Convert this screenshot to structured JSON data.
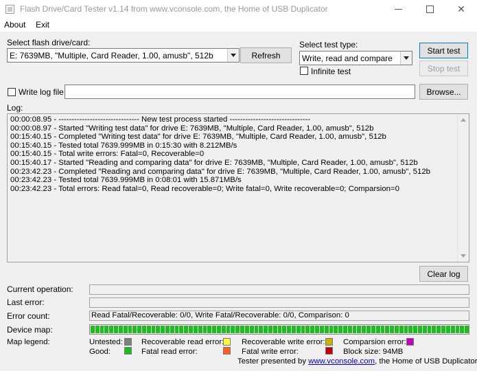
{
  "window": {
    "title": "Flash Drive/Card Tester v1.14 from www.vconsole.com, the Home of USB Duplicator"
  },
  "menu": [
    "About",
    "Exit"
  ],
  "drive": {
    "label": "Select flash drive/card:",
    "selected": "E: 7639MB, \"Multiple, Card  Reader, 1.00, amusb\", 512b",
    "refresh_label": "Refresh"
  },
  "test": {
    "label": "Select test type:",
    "selected": "Write, read and compare",
    "infinite_label": "Infinite test",
    "infinite_checked": false,
    "start_label": "Start test",
    "stop_label": "Stop test"
  },
  "logfile": {
    "write_label": "Write log file",
    "write_checked": false,
    "path": "",
    "browse_label": "Browse..."
  },
  "log": {
    "label": "Log:",
    "lines": [
      "00:00:08.95 - ------------------------------- New test process started -------------------------------",
      "00:00:08.97 - Started \"Writing test data\" for drive E: 7639MB, \"Multiple, Card  Reader, 1.00, amusb\", 512b",
      "00:15:40.15 - Completed \"Writing test data\" for drive E: 7639MB, \"Multiple, Card  Reader, 1.00, amusb\", 512b",
      "00:15:40.15 - Tested total 7639.999MB in 0:15:30 with  8.212MB/s",
      "00:15:40.15 - Total write errors: Fatal=0, Recoverable=0",
      "00:15:40.17 - Started \"Reading and comparing data\" for drive E: 7639MB, \"Multiple, Card  Reader, 1.00, amusb\", 512b",
      "00:23:42.23 - Completed \"Reading and comparing data\" for drive E: 7639MB, \"Multiple, Card  Reader, 1.00, amusb\", 512b",
      "00:23:42.23 - Tested total 7639.999MB in 0:08:01 with 15.871MB/s",
      "00:23:42.23 - Total errors: Read fatal=0, Read recoverable=0; Write fatal=0, Write recoverable=0; Comparsion=0"
    ],
    "clear_label": "Clear log"
  },
  "status": {
    "current_operation_label": "Current operation:",
    "current_operation": "",
    "last_error_label": "Last error:",
    "last_error": "",
    "error_count_label": "Error count:",
    "error_count": "Read Fatal/Recoverable: 0/0, Write Fatal/Recoverable: 0/0, Comparison: 0",
    "device_map_label": "Device map:",
    "device_map_good_fraction": 1.0
  },
  "legend": {
    "label": "Map legend:",
    "items": [
      {
        "label": "Untested:",
        "color": "#808080"
      },
      {
        "label": "Recoverable read error:",
        "color": "#ffff40"
      },
      {
        "label": "Recoverable write error:",
        "color": "#c8b400"
      },
      {
        "label": "Comparsion error:",
        "color": "#c000c0"
      },
      {
        "label": "Good:",
        "color": "#1dbd1d"
      },
      {
        "label": "Fatal read error:",
        "color": "#ff6020"
      },
      {
        "label": "Fatal write error:",
        "color": "#c00000"
      }
    ],
    "block_size": "Block size: 94MB"
  },
  "footer": {
    "prefix": "Tester presented by",
    "link": "www.vconsole.com",
    "suffix": ", the Home of USB Duplicator."
  }
}
